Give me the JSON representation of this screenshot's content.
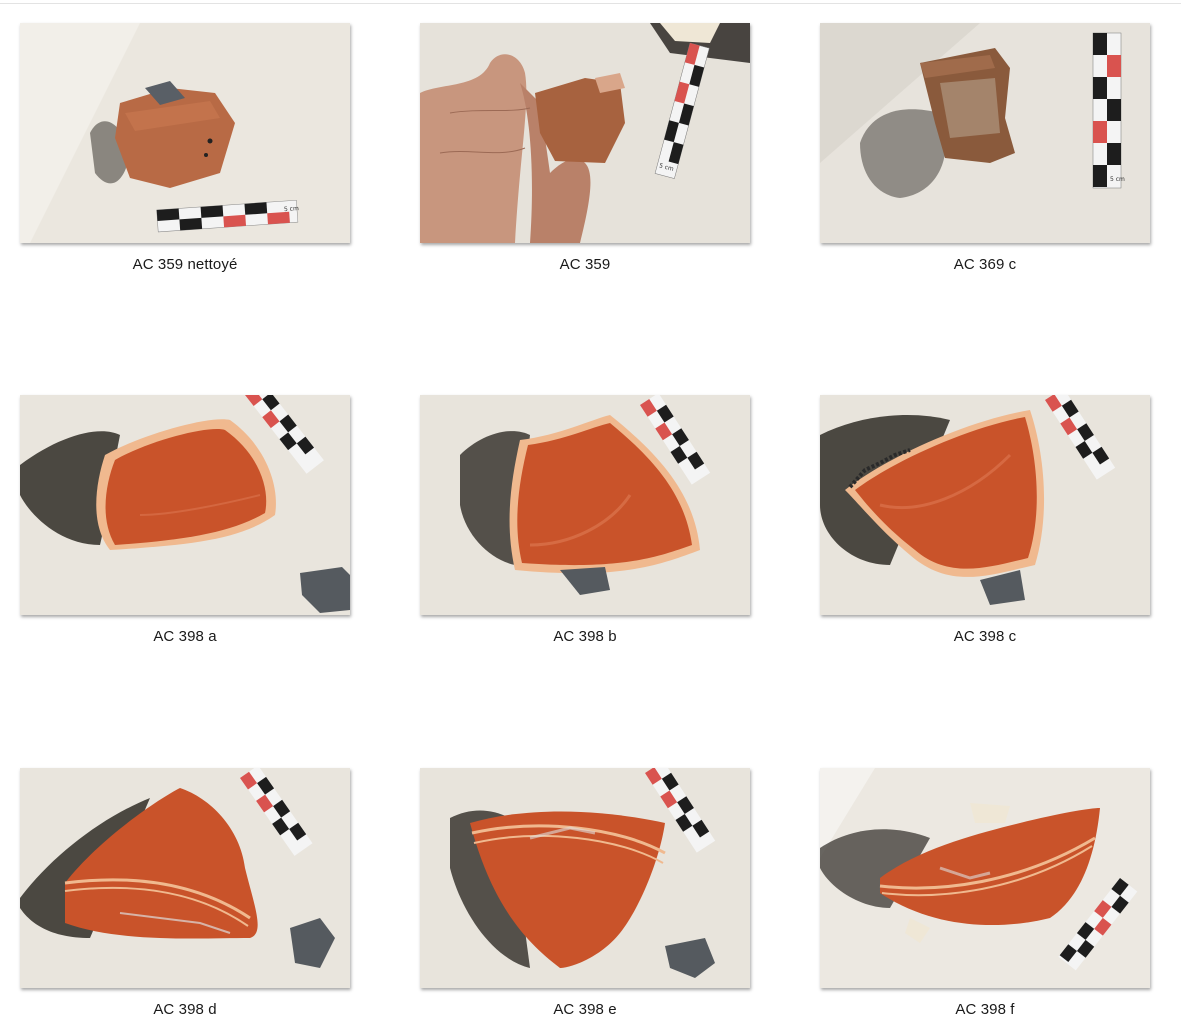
{
  "colors": {
    "fabric": "#e8e4dc",
    "shadow": "#3a3630",
    "terra_sigillata": "#c9532a",
    "sherd_light": "#b86a45",
    "sherd_dark": "#8a5a3c",
    "scale_red": "#d9534f",
    "scale_black": "#1d1d1d"
  },
  "gallery": {
    "items": [
      {
        "caption": "AC 359 nettoyé",
        "scale_label": "5 cm"
      },
      {
        "caption": "AC 359",
        "scale_label": "5 cm"
      },
      {
        "caption": "AC 369 c",
        "scale_label": "5 cm"
      },
      {
        "caption": "AC 398 a"
      },
      {
        "caption": "AC 398 b"
      },
      {
        "caption": "AC 398 c"
      },
      {
        "caption": "AC 398 d"
      },
      {
        "caption": "AC 398 e"
      },
      {
        "caption": "AC 398 f"
      }
    ]
  }
}
